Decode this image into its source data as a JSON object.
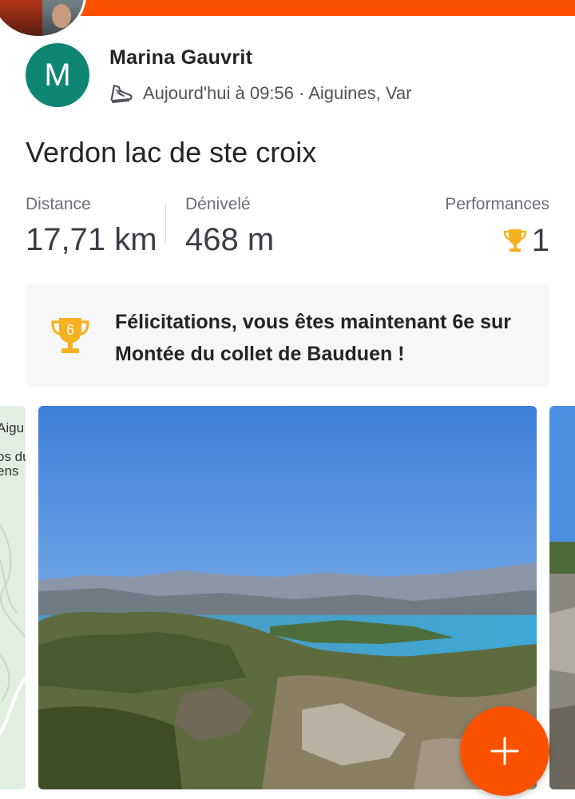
{
  "activity": {
    "athlete_name": "Marina Gauvrit",
    "avatar_initial": "M",
    "timestamp_location": "Aujourd'hui à 09:56 · Aiguines, Var",
    "title": "Verdon lac de ste croix",
    "sport_icon": "shoe-icon"
  },
  "stats": {
    "distance_label": "Distance",
    "distance_value": "17,71 km",
    "elevation_label": "Dénivelé",
    "elevation_value": "468 m",
    "performances_label": "Performances",
    "performances_value": "1"
  },
  "achievement": {
    "rank_badge": "6",
    "message": "Félicitations, vous êtes maintenant 6e sur Montée du collet de Bauduen !"
  },
  "map": {
    "labels": [
      "Aigu",
      "os du",
      "ens"
    ]
  },
  "colors": {
    "accent": "#fc5200",
    "avatar_bg": "#0f8574",
    "trophy": "#f5b120",
    "banner_bg": "#f7f7f7"
  },
  "fab": {
    "icon": "plus-icon"
  }
}
